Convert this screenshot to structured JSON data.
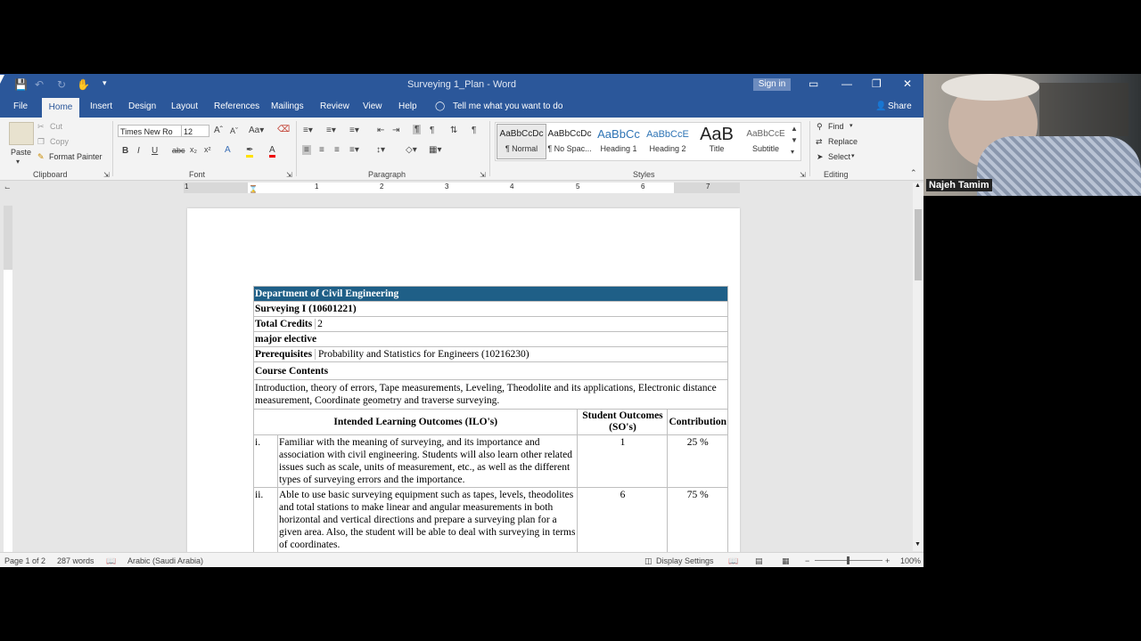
{
  "app": {
    "title": "Surveying 1_Plan  -  Word",
    "sign_in": "Sign in",
    "share": "Share",
    "tell_me": "Tell me what you want to do"
  },
  "tabs": [
    "File",
    "Home",
    "Insert",
    "Design",
    "Layout",
    "References",
    "Mailings",
    "Review",
    "View",
    "Help"
  ],
  "clipboard": {
    "paste": "Paste",
    "cut": "Cut",
    "copy": "Copy",
    "format_painter": "Format Painter",
    "group": "Clipboard"
  },
  "font": {
    "name": "Times New Ro",
    "size": "12",
    "group": "Font"
  },
  "paragraph": {
    "group": "Paragraph"
  },
  "styles": {
    "group": "Styles",
    "items": [
      {
        "preview": "AaBbCcDc",
        "name": "¶ Normal"
      },
      {
        "preview": "AaBbCcDc",
        "name": "¶ No Spac..."
      },
      {
        "preview": "AaBbCc",
        "name": "Heading 1"
      },
      {
        "preview": "AaBbCcE",
        "name": "Heading 2"
      },
      {
        "preview": "AaB",
        "name": "Title"
      },
      {
        "preview": "AaBbCcE",
        "name": "Subtitle"
      }
    ]
  },
  "editing": {
    "group": "Editing",
    "find": "Find",
    "replace": "Replace",
    "select": "Select"
  },
  "ruler_numbers": [
    "1",
    "1",
    "2",
    "3",
    "4",
    "5",
    "6",
    "7"
  ],
  "status": {
    "page": "Page 1 of 2",
    "words": "287 words",
    "language": "Arabic (Saudi Arabia)",
    "display": "Display Settings",
    "zoom": "100%"
  },
  "document": {
    "header": "Department of Civil Engineering",
    "course": "Surveying I (10601221)",
    "credits_label": "Total Credits",
    "credits_value": "2",
    "major": "major elective",
    "prereq_label": "Prerequisites",
    "prereq_value": "Probability and Statistics for Engineers (10216230)",
    "contents_label": "Course Contents",
    "contents": "Introduction, theory of errors, Tape measurements, Leveling, Theodolite and its applications, Electronic distance measurement, Coordinate geometry and traverse surveying.",
    "col_ilo": "Intended Learning Outcomes (ILO's)",
    "col_so": "Student Outcomes (SO's)",
    "col_contrib": "Contribution",
    "rows": [
      {
        "num": "i.",
        "text": "Familiar with the meaning of surveying, and its importance and association with civil engineering. Students will also learn other related issues such as scale, units of measurement, etc., as well as the different types of surveying errors and the importance.",
        "so": "1",
        "contrib": "25 %"
      },
      {
        "num": "ii.",
        "text": "Able to use basic surveying equipment such as tapes, levels, theodolites and total stations to make linear and angular measurements in both horizontal and vertical directions and prepare a surveying plan for a given area. Also, the student will be able to deal with surveying in terms of coordinates.",
        "so": "6",
        "contrib": "75 %"
      }
    ]
  },
  "participant": {
    "name": "Najeh Tamim"
  }
}
